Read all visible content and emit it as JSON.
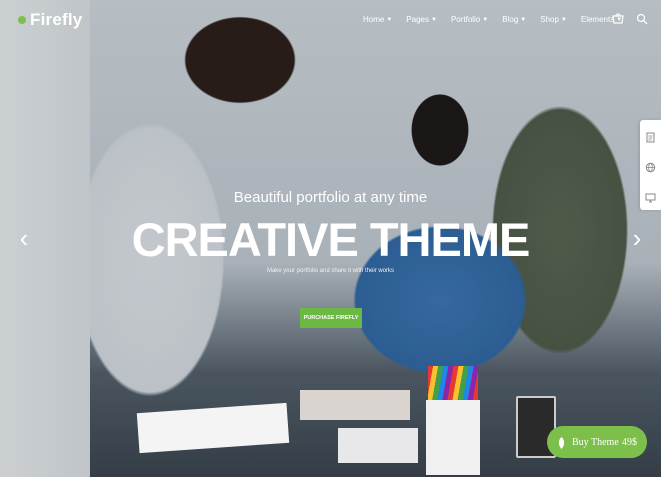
{
  "brand": {
    "name": "Firefly",
    "accent": "#7cc04b"
  },
  "nav": {
    "items": [
      {
        "label": "Home",
        "icon": "chevron-down-icon"
      },
      {
        "label": "Pages",
        "icon": "chevron-down-icon"
      },
      {
        "label": "Portfolio",
        "icon": "chevron-down-icon"
      },
      {
        "label": "Blog",
        "icon": "chevron-down-icon"
      },
      {
        "label": "Shop",
        "icon": "chevron-down-icon"
      },
      {
        "label": "Elements",
        "icon": "chevron-down-icon"
      }
    ],
    "icons": [
      "cart-icon",
      "search-icon"
    ]
  },
  "hero": {
    "subtitle": "Beautiful portfolio at any time",
    "title": "CREATIVE THEME",
    "description": "Make your portfolio and share it with their works",
    "cta_label": "PURCHASE FIREFLY"
  },
  "side_panel": {
    "icons": [
      "document-icon",
      "globe-icon",
      "monitor-icon"
    ]
  },
  "slider": {
    "prev_icon": "chevron-left-icon",
    "next_icon": "chevron-right-icon"
  },
  "buy_button": {
    "label": "Buy Theme",
    "price": "49$",
    "icon": "leaf-icon"
  }
}
